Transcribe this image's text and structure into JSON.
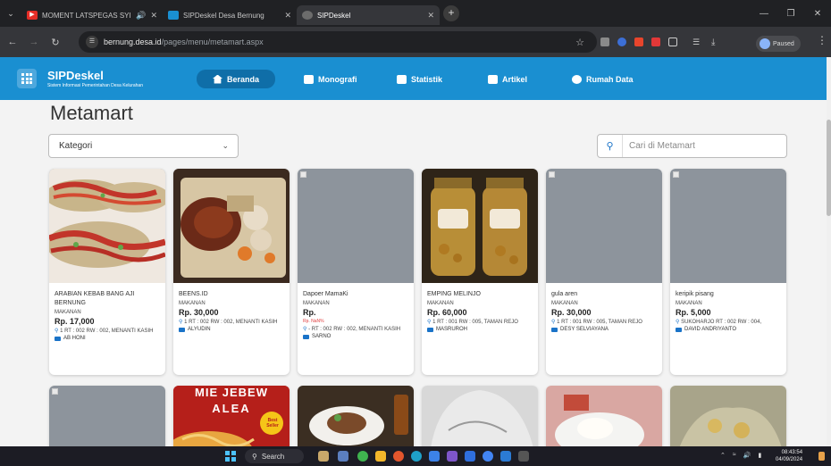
{
  "browser": {
    "tabs": [
      {
        "title": "MOMENT LATSPEGAS SYIL",
        "active": false,
        "favicon": "youtube-icon"
      },
      {
        "title": "SIPDeskel Desa Bernung",
        "active": false,
        "favicon": "sipdeskel-icon"
      },
      {
        "title": "SIPDeskel",
        "active": true,
        "favicon": "globe-icon"
      }
    ],
    "url_host": "bernung.desa.id",
    "url_path": "/pages/menu/metamart.aspx",
    "profile_status": "Paused"
  },
  "site": {
    "brand_title": "SIPDeskel",
    "brand_subtitle": "Sistem Informasi Pemerintahan Desa Kelurahan",
    "nav": [
      {
        "label": "Beranda",
        "icon": "home-icon",
        "active": true
      },
      {
        "label": "Monografi",
        "icon": "chart-icon",
        "active": false
      },
      {
        "label": "Statistik",
        "icon": "stats-icon",
        "active": false
      },
      {
        "label": "Artikel",
        "icon": "article-icon",
        "active": false
      },
      {
        "label": "Rumah Data",
        "icon": "people-icon",
        "active": false
      }
    ]
  },
  "page": {
    "title": "Metamart",
    "category_select": "Kategori",
    "search_placeholder": "Cari di Metamart"
  },
  "products": [
    {
      "name": "ARABIAN KEBAB BANG AJI BERNUNG",
      "category": "MAKANAN",
      "price": "Rp. 17,000",
      "address": "1 RT : 002 RW : 002, MENANTI KASIH",
      "seller": "AB HONI"
    },
    {
      "name": "BEENS.ID",
      "category": "MAKANAN",
      "price": "Rp. 30,000",
      "address": "1 RT : 002 RW : 002, MENANTI KASIH",
      "seller": "ALYUDIN"
    },
    {
      "name": "Dapoer MamaKi",
      "category": "MAKANAN",
      "price": "Rp.",
      "price_extra": "Rp. NaN%",
      "address": "- RT : 002 RW : 002, MENANTI KASIH",
      "seller": "SARNO"
    },
    {
      "name": "EMPING MELINJO",
      "category": "MAKANAN",
      "price": "Rp. 60,000",
      "address": "1 RT : 001 RW : 005, TAMAN REJO",
      "seller": "MASRUROH"
    },
    {
      "name": "gula aren",
      "category": "MAKANAN",
      "price": "Rp. 30,000",
      "address": "1 RT : 001 RW : 005, TAMAN REJO",
      "seller": "DESY SELVIAYANA"
    },
    {
      "name": "keripik pisang",
      "category": "MAKANAN",
      "price": "Rp. 5,000",
      "address": "SUKOHARJO RT : 002 RW : 004,",
      "seller": "DAVID ANDRIYANTO"
    }
  ],
  "row2_banner": {
    "line1": "MIE JEBEW",
    "line2": "ALEA",
    "badge": "Best Seller"
  },
  "taskbar": {
    "search": "Search",
    "time": "08:43:54",
    "date": "04/09/2024"
  }
}
